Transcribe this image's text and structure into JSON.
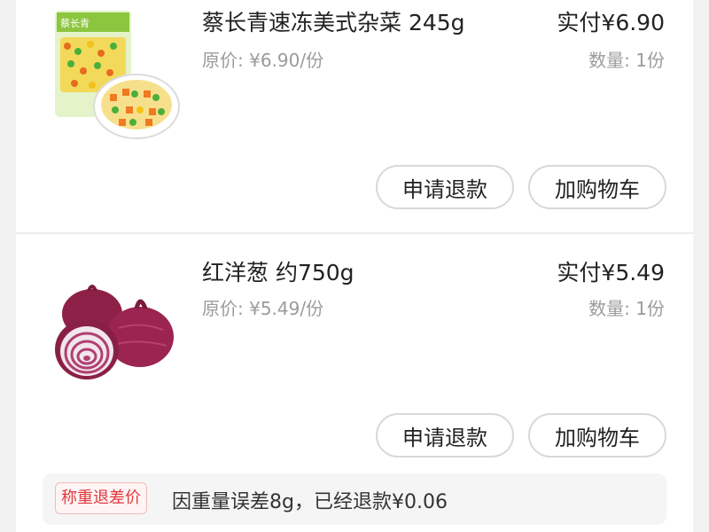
{
  "orders": [
    {
      "title": "蔡长青速冻美式杂菜 245g",
      "original_price": "原价: ¥6.90/份",
      "paid": "实付¥6.90",
      "quantity": "数量: 1份",
      "refund_label": "申请退款",
      "cart_label": "加购物车",
      "image_icon": "frozen-mixed-vegetables-image",
      "package_brand": "蔡长青"
    },
    {
      "title": "红洋葱 约750g",
      "original_price": "原价: ¥5.49/份",
      "paid": "实付¥5.49",
      "quantity": "数量: 1份",
      "refund_label": "申请退款",
      "cart_label": "加购物车",
      "image_icon": "red-onion-image"
    }
  ],
  "weight_refund": {
    "badge": "称重退差价",
    "text": "因重量误差8g，已经退款¥0.06"
  },
  "colors": {
    "badge_text": "#e0393e",
    "badge_border": "#f2b8b8",
    "package_green": "#8cc63f"
  }
}
